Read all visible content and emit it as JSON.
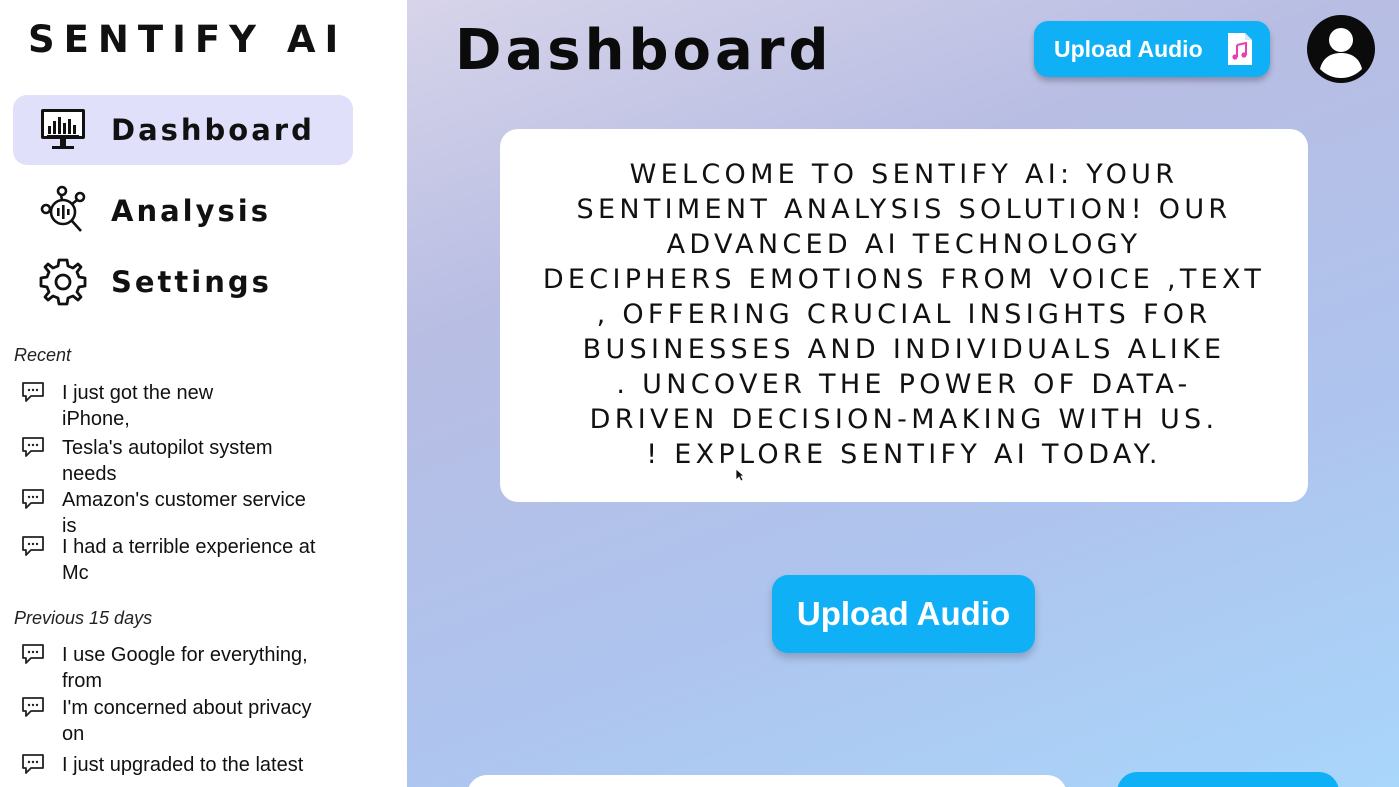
{
  "app": {
    "brand": "SENTIFY AI"
  },
  "sidebar": {
    "nav": [
      {
        "label": "Dashboard",
        "icon": "monitor-chart-icon",
        "active": true
      },
      {
        "label": "Analysis",
        "icon": "analysis-network-icon",
        "active": false
      },
      {
        "label": "Settings",
        "icon": "gear-icon",
        "active": false
      }
    ],
    "recent_title": "Recent",
    "recent": [
      {
        "text": "I just got the new\niPhone,"
      },
      {
        "text": "Tesla's autopilot system\nneeds"
      },
      {
        "text": "Amazon's customer service\nis"
      },
      {
        "text": "I had a terrible experience at\nMc"
      }
    ],
    "previous_title": "Previous 15 days",
    "previous": [
      {
        "text": "I use Google for everything,\nfrom"
      },
      {
        "text": "I'm concerned about privacy\non"
      },
      {
        "text": "I just upgraded to the latest"
      }
    ]
  },
  "header": {
    "title": "Dashboard",
    "upload_label": "Upload Audio",
    "upload_icon": "music-file-icon",
    "avatar_icon": "user-avatar-icon"
  },
  "main": {
    "welcome": "WELCOME TO SENTIFY AI: YOUR\nSENTIMENT ANALYSIS SOLUTION! OUR\nADVANCED AI TECHNOLOGY\nDECIPHERS EMOTIONS FROM VOICE ,TEXT\n, OFFERING CRUCIAL INSIGHTS FOR\nBUSINESSES AND INDIVIDUALS ALIKE\n. UNCOVER THE POWER OF DATA-\nDRIVEN DECISION-MAKING WITH US.\n! EXPLORE SENTIFY AI TODAY.",
    "upload_label": "Upload Audio"
  },
  "colors": {
    "accent": "#10b0f6",
    "active_nav_bg": "#e1e0fb",
    "gradient_top": "#d7d4ea",
    "gradient_bottom": "#a9d6fb"
  }
}
